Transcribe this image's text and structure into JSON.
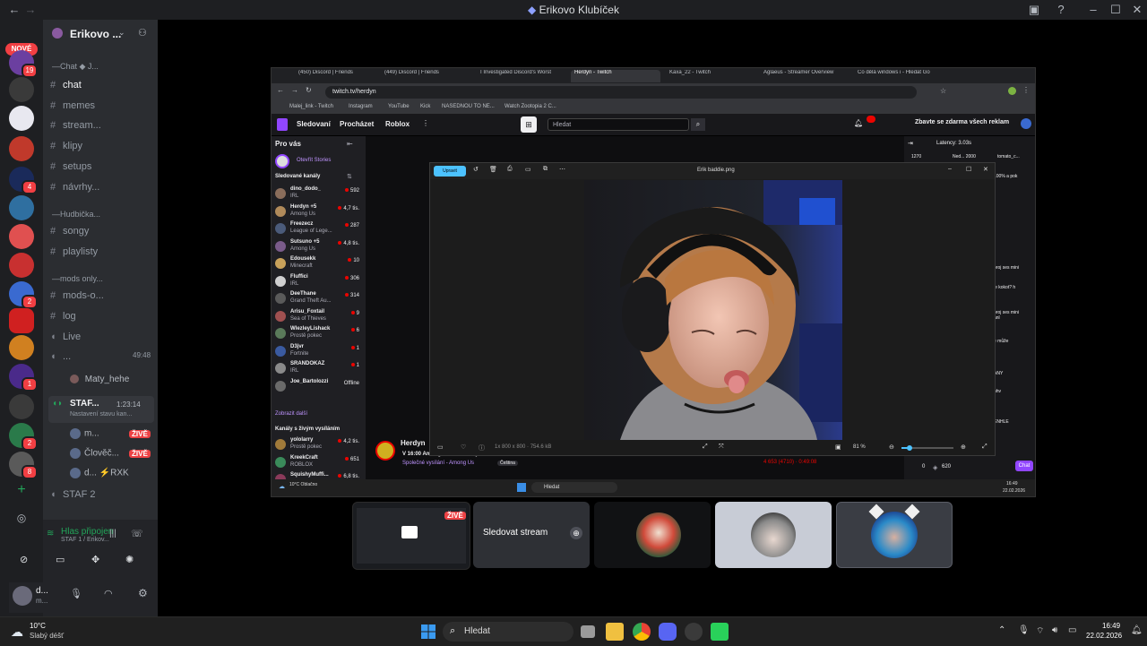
{
  "window": {
    "title": "Erikovo Klubíček"
  },
  "server_rail": {
    "new_badge": "NOVÉ",
    "badges": [
      "19",
      "4",
      "2",
      "1",
      "2",
      "1",
      "8"
    ]
  },
  "guild": {
    "name": "Erikovo ..."
  },
  "channels": [
    {
      "label": "Chat ◆ J...",
      "kind": "category"
    },
    {
      "label": "chat",
      "kind": "text",
      "active": true
    },
    {
      "label": "memes",
      "kind": "text"
    },
    {
      "label": "stream...",
      "kind": "text"
    },
    {
      "label": "klipy",
      "kind": "text"
    },
    {
      "label": "setups",
      "kind": "text"
    },
    {
      "label": "návrhy...",
      "kind": "text"
    },
    {
      "label": "Hudbička...",
      "kind": "category"
    },
    {
      "label": "songy",
      "kind": "text"
    },
    {
      "label": "playlisty",
      "kind": "text"
    },
    {
      "label": "mods only...",
      "kind": "category"
    },
    {
      "label": "mods-o...",
      "kind": "text"
    },
    {
      "label": "log",
      "kind": "text"
    },
    {
      "label": "Live",
      "kind": "voice"
    },
    {
      "label": "...",
      "kind": "voice",
      "timer": "49:48"
    }
  ],
  "voice_users_a": [
    {
      "name": "Maty_hehe"
    }
  ],
  "stage_channel": {
    "label": "STAF...",
    "timer": "1:23:14",
    "status": "Nastavení stavu kan..."
  },
  "stage_users": [
    {
      "name": "m...",
      "live": "ŽIVĚ"
    },
    {
      "name": "Člověč...",
      "live": "ŽIVĚ"
    },
    {
      "name": "d... ⚡RXK",
      "live": ""
    }
  ],
  "staf2": {
    "label": "STAF 2"
  },
  "voice_connected": {
    "title": "Hlas připojen",
    "sub": "STAF 1 / Erikov..."
  },
  "user_panel": {
    "name": "d...",
    "status": "m..."
  },
  "browser": {
    "tabs": [
      {
        "label": "(450) Discord | Friends"
      },
      {
        "label": "(449) Discord | Friends"
      },
      {
        "label": "I Investigated Discord's Worst"
      },
      {
        "label": "Herdyn - Twitch",
        "active": true
      },
      {
        "label": "Kaxa_22 - Twitch"
      },
      {
        "label": "Aglaeus - Streamer Overview"
      },
      {
        "label": "Co dělá windows i - Hledat Go"
      }
    ],
    "url": "twitch.tv/herdyn",
    "bookmarks": [
      "Malej_link - Twitch",
      "Instagram",
      "YouTube",
      "Kick",
      "NASEDNOU TO NE...",
      "Watch Zootopia 2 C..."
    ]
  },
  "twitch": {
    "nav": [
      "Sledovaní",
      "Procházet",
      "Roblox"
    ],
    "search_placeholder": "Hledat",
    "promo": "Zbavte se zdarma všech reklam",
    "for_you": "Pro vás",
    "stories": "Otevřít Stories",
    "followed_header": "Sledované kanály",
    "channels": [
      {
        "name": "dino_dodo_",
        "game": "IRL",
        "viewers": "592",
        "color": "#8a6d5b"
      },
      {
        "name": "Herdyn +5",
        "game": "Among Us",
        "viewers": "4,7 tis.",
        "color": "#b08a5a"
      },
      {
        "name": "Freezecz",
        "game": "League of Lege...",
        "viewers": "287",
        "color": "#4b5b7a"
      },
      {
        "name": "Sutsuno +5",
        "game": "Among Us",
        "viewers": "4,8 tis.",
        "color": "#7a5b8a"
      },
      {
        "name": "Edousekk",
        "game": "Minecraft",
        "viewers": "10",
        "color": "#c9a25a"
      },
      {
        "name": "Fluffici",
        "game": "IRL",
        "viewers": "306",
        "color": "#d0d0d0"
      },
      {
        "name": "DeeThane",
        "game": "Grand Theft Au...",
        "viewers": "314",
        "color": "#5a5a5a"
      },
      {
        "name": "Arisu_Foxtail",
        "game": "Sea of Thieves",
        "viewers": "9",
        "color": "#a05050"
      },
      {
        "name": "WlezleyLishack",
        "game": "Prostě pokec",
        "viewers": "6",
        "color": "#5a7a5a"
      },
      {
        "name": "D3jvr",
        "game": "Fortnite",
        "viewers": "1",
        "color": "#3a5aa0"
      },
      {
        "name": "SRANDOKAZ",
        "game": "IRL",
        "viewers": "1",
        "color": "#8a8a8a"
      },
      {
        "name": "Joe_Bartolozzi",
        "game": "",
        "viewers": "Offline",
        "color": "#6a6a6a"
      }
    ],
    "show_more": "Zobrazit další",
    "live_header": "Kanály s živým vysíláním",
    "live_channels": [
      {
        "name": "yololarry",
        "game": "Prostě pokec",
        "viewers": "4,2 tis.",
        "color": "#a07a3a"
      },
      {
        "name": "KreekCraft",
        "game": "ROBLOX",
        "viewers": "651",
        "color": "#3a8a5a"
      },
      {
        "name": "SquishyMuffi...",
        "game": "",
        "viewers": "6,8 tis.",
        "color": "#8a3a5a"
      }
    ],
    "streamer": "Herdyn",
    "stream_title": "V 16:00 Among us se Slovany",
    "stream_tags": [
      "Společné vysílání - Among Us",
      "Čeština"
    ],
    "stream_stats": "4 653 (4710) · 0:49:08",
    "latency": "Latency: 3.03s",
    "chat_lines": [
      "1270",
      "Ned... 2000",
      "tomato_c...",
      "100% a pok",
      "proj ses mini",
      "je kokot? h",
      "proj ses mini",
      "anl",
      "e může",
      "ANY",
      "hhv",
      "ENHLE"
    ],
    "chat_button": "Chat",
    "chat_points": "620",
    "chat_count": "0"
  },
  "viewer": {
    "file": "Erik baddie.png",
    "edit": "Upravit",
    "info": "1x 800 x 800  ·  754.6 kB",
    "zoom": "81 %"
  },
  "stream_taskbar": {
    "search": "Hledat",
    "time": "16:49",
    "date": "22.02.2026",
    "weather": "10°C Oblačno"
  },
  "tiles": [
    {
      "kind": "screen",
      "live": "ŽIVĚ"
    },
    {
      "kind": "watch",
      "label": "Sledovat stream"
    },
    {
      "kind": "avatar",
      "icon": "joker-avatar"
    },
    {
      "kind": "avatar",
      "icon": "dog-avatar"
    },
    {
      "kind": "avatar",
      "icon": "catears-avatar"
    }
  ],
  "taskbar": {
    "weather_temp": "10°C",
    "weather_text": "Slabý déšť",
    "search": "Hledat",
    "time": "16:49",
    "date": "22.02.2026"
  }
}
